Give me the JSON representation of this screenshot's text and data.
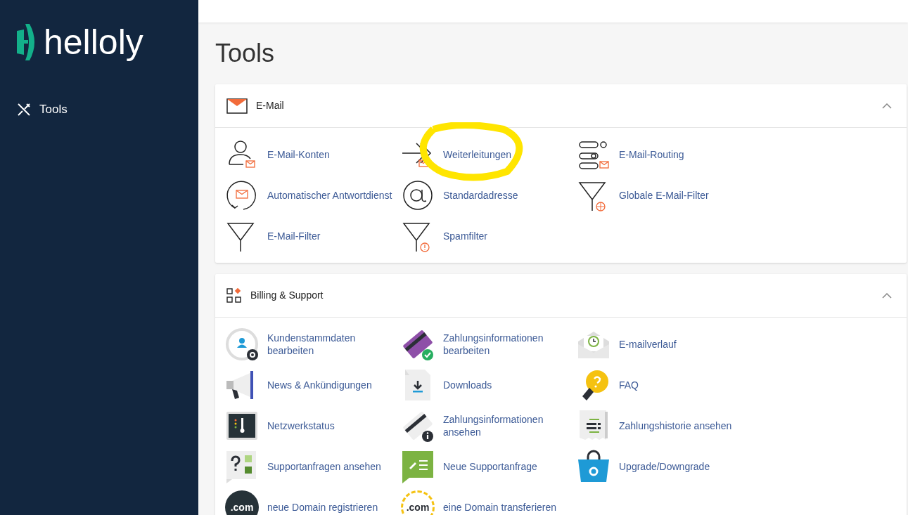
{
  "sidebar": {
    "logo": "helloly",
    "items": [
      {
        "label": "Tools",
        "selected": true
      }
    ]
  },
  "page_title": "Tools",
  "sections": [
    {
      "title": "E-Mail",
      "expanded": true,
      "items": [
        {
          "label": "E-Mail-Konten",
          "highlighted": false
        },
        {
          "label": "Weiterleitungen",
          "highlighted": true
        },
        {
          "label": "E-Mail-Routing",
          "highlighted": false
        },
        {
          "label": "Automatischer Antwortdienst",
          "highlighted": false
        },
        {
          "label": "Standardadresse",
          "highlighted": false
        },
        {
          "label": "Globale E-Mail-Filter",
          "highlighted": false
        },
        {
          "label": "E-Mail-Filter",
          "highlighted": false
        },
        {
          "label": "Spamfilter",
          "highlighted": false
        }
      ]
    },
    {
      "title": "Billing & Support",
      "expanded": true,
      "items": [
        {
          "label": "Kundenstammdaten bearbeiten",
          "highlighted": false
        },
        {
          "label": "Zahlungsinformationen bearbeiten",
          "highlighted": false
        },
        {
          "label": "E-mailverlauf",
          "highlighted": false
        },
        {
          "label": "News & Ankündigungen",
          "highlighted": false
        },
        {
          "label": "Downloads",
          "highlighted": false
        },
        {
          "label": "FAQ",
          "highlighted": false
        },
        {
          "label": "Netzwerkstatus",
          "highlighted": false
        },
        {
          "label": "Zahlungsinformationen ansehen",
          "highlighted": false
        },
        {
          "label": "Zahlungshistorie ansehen",
          "highlighted": false
        },
        {
          "label": "Supportanfragen ansehen",
          "highlighted": false
        },
        {
          "label": "Neue Supportanfrage",
          "highlighted": false
        },
        {
          "label": "Upgrade/Downgrade",
          "highlighted": false
        },
        {
          "label": "neue Domain registrieren",
          "highlighted": false,
          "icon_text": ".com"
        },
        {
          "label": "eine Domain transferieren",
          "highlighted": false,
          "icon_text": ".com"
        }
      ]
    }
  ]
}
